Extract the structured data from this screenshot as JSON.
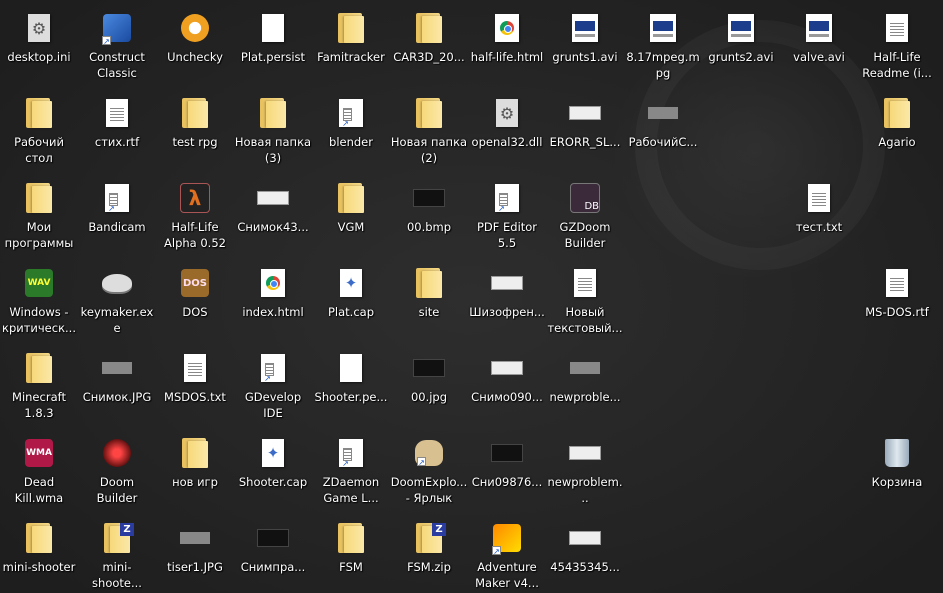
{
  "desktop": {
    "icons": [
      {
        "label": "desktop.ini",
        "icon": "gear-file-icon"
      },
      {
        "label": "Construct Classic",
        "icon": "construct-icon"
      },
      {
        "label": "Unchecky",
        "icon": "unchecky-icon"
      },
      {
        "label": "Plat.persist",
        "icon": "blank-file-icon"
      },
      {
        "label": "Famitracker",
        "icon": "folder-icon"
      },
      {
        "label": "CAR3D_20...",
        "icon": "folder-icon"
      },
      {
        "label": "half-life.html",
        "icon": "chrome-html-icon"
      },
      {
        "label": "grunts1.avi",
        "icon": "video-file-icon"
      },
      {
        "label": "8.17mpeg.mpg",
        "icon": "video-file-icon"
      },
      {
        "label": "grunts2.avi",
        "icon": "video-file-icon"
      },
      {
        "label": "valve.avi",
        "icon": "video-file-icon"
      },
      {
        "label": "Half-Life Readme (i...",
        "icon": "document-file-icon"
      },
      {
        "label": "Рабочий стол",
        "icon": "folder-icon"
      },
      {
        "label": "стих.rtf",
        "icon": "document-file-icon"
      },
      {
        "label": "test rpg",
        "icon": "folder-icon"
      },
      {
        "label": "Новая папка (3)",
        "icon": "folder-icon"
      },
      {
        "label": "blender",
        "icon": "shortcut-icon"
      },
      {
        "label": "Новая папка (2)",
        "icon": "folder-icon"
      },
      {
        "label": "openal32.dll",
        "icon": "gear-file-icon"
      },
      {
        "label": "ERORR_SL...",
        "icon": "image-thumb-icon"
      },
      {
        "label": "РабочийС...",
        "icon": "image-thumb-icon"
      },
      {
        "label": "Agario",
        "icon": "folder-icon"
      },
      {
        "label": "Мои программы",
        "icon": "folder-icon"
      },
      {
        "label": "Bandicam",
        "icon": "shortcut-icon"
      },
      {
        "label": "Half-Life Alpha 0.52",
        "icon": "half-life-icon"
      },
      {
        "label": "Снимок43...",
        "icon": "image-thumb-icon"
      },
      {
        "label": "VGM",
        "icon": "folder-icon"
      },
      {
        "label": "00.bmp",
        "icon": "image-thumb-icon"
      },
      {
        "label": "PDF Editor 5.5",
        "icon": "shortcut-icon"
      },
      {
        "label": "GZDoom Builder",
        "icon": "gzdoom-icon"
      },
      {
        "label": "тест.txt",
        "icon": "text-file-icon"
      },
      {
        "label": "Windows - критическ...",
        "icon": "wav-icon"
      },
      {
        "label": "keymaker.exe",
        "icon": "keymaker-icon"
      },
      {
        "label": "DOS",
        "icon": "dos-icon"
      },
      {
        "label": "index.html",
        "icon": "chrome-html-icon"
      },
      {
        "label": "Plat.cap",
        "icon": "cap-file-icon"
      },
      {
        "label": "site",
        "icon": "folder-icon"
      },
      {
        "label": "Шизофрен...",
        "icon": "image-thumb-icon"
      },
      {
        "label": "Новый текстовый...",
        "icon": "text-file-icon"
      },
      {
        "label": "MS-DOS.rtf",
        "icon": "document-file-icon"
      },
      {
        "label": "Minecraft 1.8.3",
        "icon": "folder-icon"
      },
      {
        "label": "Снимок.JPG",
        "icon": "image-thumb-icon"
      },
      {
        "label": "MSDOS.txt",
        "icon": "text-file-icon"
      },
      {
        "label": "GDevelop IDE",
        "icon": "shortcut-icon"
      },
      {
        "label": "Shooter.pe...",
        "icon": "blank-file-icon"
      },
      {
        "label": "00.jpg",
        "icon": "image-thumb-icon"
      },
      {
        "label": "Снимо090...",
        "icon": "image-thumb-icon"
      },
      {
        "label": "newproble...",
        "icon": "image-thumb-icon"
      },
      {
        "label": "Dead Kill.wma",
        "icon": "wma-icon"
      },
      {
        "label": "Doom Builder",
        "icon": "doom-builder-icon"
      },
      {
        "label": "нов игр",
        "icon": "folder-icon"
      },
      {
        "label": "Shooter.cap",
        "icon": "cap-file-icon"
      },
      {
        "label": "ZDaemon Game L...",
        "icon": "shortcut-icon"
      },
      {
        "label": "DoomExplo... - Ярлык",
        "icon": "doom-explorer-icon"
      },
      {
        "label": "Сни09876...",
        "icon": "image-thumb-icon"
      },
      {
        "label": "newproblem...",
        "icon": "image-thumb-icon"
      },
      {
        "label": "Корзина",
        "icon": "recycle-bin-icon"
      },
      {
        "label": "mini-shooter",
        "icon": "folder-icon"
      },
      {
        "label": "mini-shoote...",
        "icon": "zip-folder-icon"
      },
      {
        "label": "tiser1.JPG",
        "icon": "image-thumb-icon"
      },
      {
        "label": "Снимпра...",
        "icon": "image-thumb-icon"
      },
      {
        "label": "FSM",
        "icon": "folder-icon"
      },
      {
        "label": "FSM.zip",
        "icon": "zip-folder-icon"
      },
      {
        "label": "Adventure Maker v4...",
        "icon": "adventure-maker-icon"
      },
      {
        "label": "45435345...",
        "icon": "image-thumb-icon"
      }
    ]
  }
}
